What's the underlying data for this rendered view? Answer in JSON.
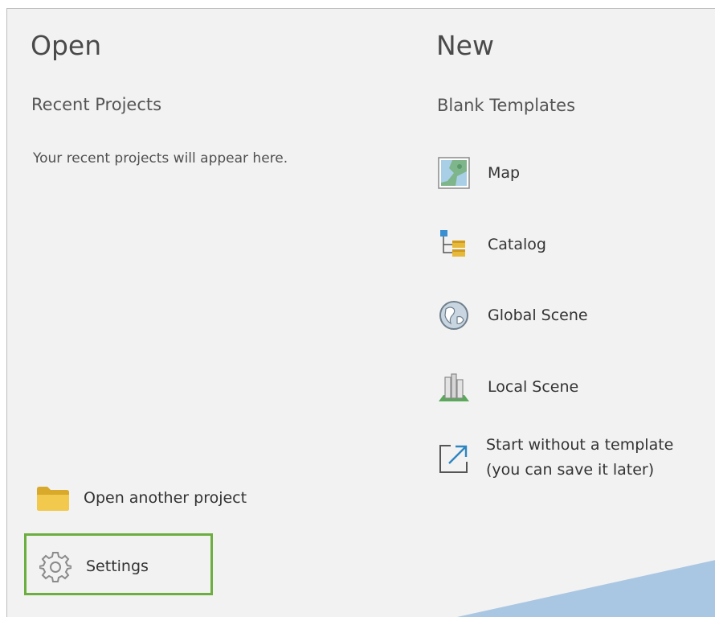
{
  "open": {
    "title": "Open",
    "recent_title": "Recent Projects",
    "recent_empty": "Your recent projects will appear here.",
    "open_another_label": "Open another project",
    "settings_label": "Settings"
  },
  "new": {
    "title": "New",
    "blank_title": "Blank Templates",
    "templates": [
      {
        "label": "Map",
        "icon": "map-icon"
      },
      {
        "label": "Catalog",
        "icon": "catalog-icon"
      },
      {
        "label": "Global Scene",
        "icon": "globe-icon"
      },
      {
        "label": "Local Scene",
        "icon": "local-scene-icon"
      },
      {
        "label": "Start without a template (you can save it later)",
        "icon": "open-external-icon"
      }
    ]
  },
  "colors": {
    "background": "#f2f2f2",
    "highlight": "#6cae3f",
    "accent_shape": "#a9c7e3"
  }
}
